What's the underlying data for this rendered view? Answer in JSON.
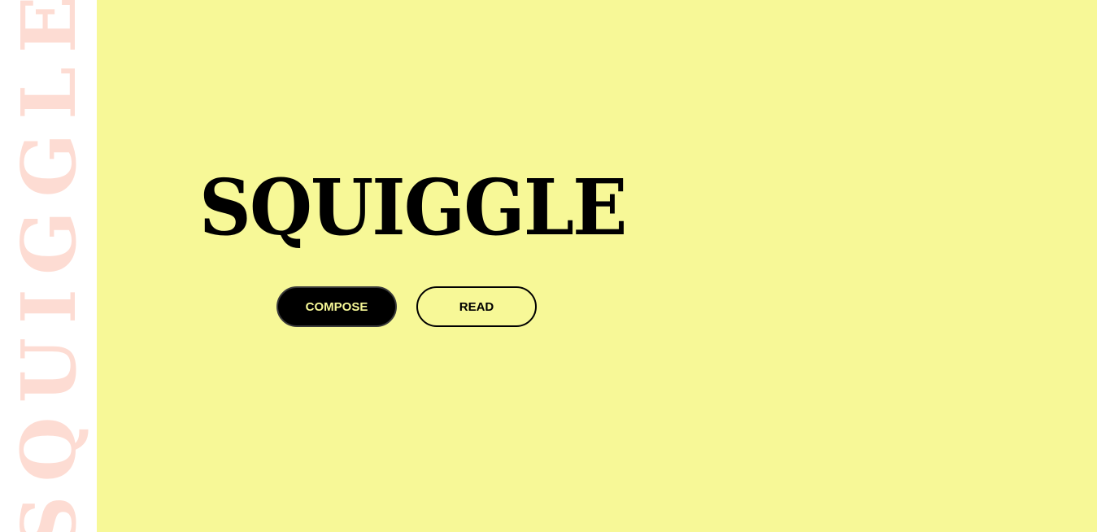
{
  "sidebar": {
    "vertical_word": "SQUIGGLE"
  },
  "hero": {
    "title": "SQUIGGLE",
    "compose_label": "COMPOSE",
    "read_label": "READ"
  },
  "colors": {
    "background": "#f7f897",
    "sidebar_background": "#ffffff",
    "sidebar_text": "#fddcd3",
    "title_text": "#000000",
    "compose_button_bg": "#000000",
    "compose_button_text": "#f7f897",
    "read_button_border": "#000000"
  }
}
